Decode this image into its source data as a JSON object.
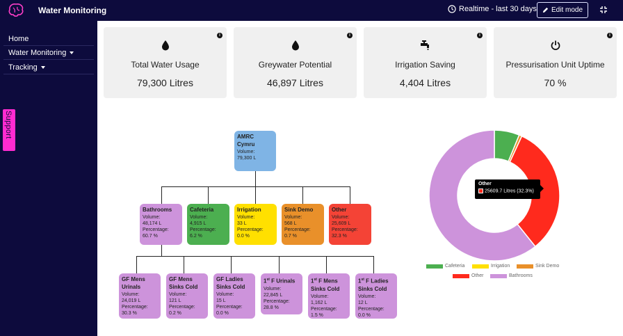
{
  "header": {
    "title": "Water Monitoring",
    "realtime_label": "Realtime - last 30 days",
    "edit_label": "Edit mode"
  },
  "sidebar": {
    "items": [
      {
        "label": "Home"
      },
      {
        "label": "Water Monitoring"
      },
      {
        "label": "Tracking"
      }
    ],
    "support_label": "Support"
  },
  "kpis": [
    {
      "label": "Total Water Usage",
      "value": "79,300 Litres",
      "icon": "water-drop-icon"
    },
    {
      "label": "Greywater Potential",
      "value": "46,897 Litres",
      "icon": "water-drop-icon"
    },
    {
      "label": "Irrigation Saving",
      "value": "4,404 Litres",
      "icon": "tap-icon"
    },
    {
      "label": "Pressurisation Unit Uptime",
      "value": "70 %",
      "icon": "power-icon"
    }
  ],
  "tree": {
    "root": {
      "title1": "AMRC",
      "title2": "Cymru",
      "l1": "Volume:",
      "l2": "79,300 L"
    },
    "level1": [
      {
        "title": "Bathrooms",
        "l1": "Volume:",
        "l2": "48,174 L",
        "l3": "Percentage:",
        "l4": "60.7 %"
      },
      {
        "title": "Cafeteria",
        "l1": "Volume:",
        "l2": "4,915 L",
        "l3": "Percentage:",
        "l4": "6.2 %"
      },
      {
        "title": "Irrigation",
        "l1": "Volume:",
        "l2": "33 L",
        "l3": "Percentage:",
        "l4": "0.0 %"
      },
      {
        "title": "Sink Demo",
        "l1": "Volume:",
        "l2": "568 L",
        "l3": "Percentage:",
        "l4": "0.7 %"
      },
      {
        "title": "Other",
        "l1": "Volume:",
        "l2": "25,609 L",
        "l3": "Percentage:",
        "l4": "32.3 %"
      }
    ],
    "level2": [
      {
        "t1": "GF Mens",
        "t2": "Urinals",
        "l1": "Volume:",
        "l2": "24,019 L",
        "l3": "Percentage:",
        "l4": "30.3 %"
      },
      {
        "t1": "GF Mens",
        "t2": "Sinks Cold",
        "l1": "Volume:",
        "l2": "121 L",
        "l3": "Percentage:",
        "l4": "0.2 %"
      },
      {
        "t1": "GF Ladies",
        "t2": "Sinks Cold",
        "l1": "Volume:",
        "l2": "15 L",
        "l3": "Percentage:",
        "l4": "0.0 %"
      },
      {
        "t1": "1st F Urinals",
        "t2": "",
        "l1": "Volume:",
        "l2": "22,845 L",
        "l3": "Percentage:",
        "l4": "28.8 %"
      },
      {
        "t1": "1st F Mens",
        "t2": "Sinks Cold",
        "l1": "Volume:",
        "l2": "1,162 L",
        "l3": "Percentage:",
        "l4": "1.5 %"
      },
      {
        "t1": "1st F Ladies",
        "t2": "Sinks Cold",
        "l1": "Volume:",
        "l2": "12 L",
        "l3": "Percentage:",
        "l4": "0.0 %"
      }
    ]
  },
  "colors": {
    "bathrooms": "#cd93db",
    "cafeteria": "#4caf50",
    "irrigation": "#ffe000",
    "sink_demo": "#e9902a",
    "other": "#ff2a1d",
    "root": "#7fb4e5"
  },
  "tooltip": {
    "title": "Other",
    "text": "25609.7 Litres (32.3%)"
  },
  "chart_data": {
    "type": "pie",
    "categories": [
      "Cafeteria",
      "Irrigation",
      "Sink Demo",
      "Other",
      "Bathrooms"
    ],
    "values": [
      6.2,
      0.0,
      0.7,
      32.3,
      60.7
    ],
    "colors": [
      "#4caf50",
      "#ffe000",
      "#e9902a",
      "#ff2a1d",
      "#cd93db"
    ],
    "legend": "bottom"
  }
}
